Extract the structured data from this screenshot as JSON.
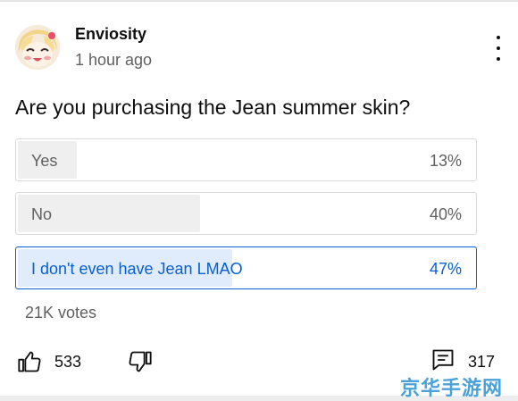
{
  "post": {
    "author": "Enviosity",
    "time": "1 hour ago",
    "question": "Are you purchasing the Jean summer skin?"
  },
  "poll": {
    "options": [
      {
        "label": "Yes",
        "percent_text": "13%",
        "percent": 13,
        "selected": false
      },
      {
        "label": "No",
        "percent_text": "40%",
        "percent": 40,
        "selected": false
      },
      {
        "label": "I don't even have Jean LMAO",
        "percent_text": "47%",
        "percent": 47,
        "selected": true
      }
    ],
    "votes": "21K votes"
  },
  "actions": {
    "likes": "533",
    "comments": "317"
  },
  "icons": {
    "menu": "more-vert-icon",
    "like": "thumbs-up-icon",
    "dislike": "thumbs-down-icon",
    "comment": "comment-icon"
  },
  "colors": {
    "accent": "#065fd4",
    "selected_fill": "#e0ecfc",
    "bar_fill": "#efefef",
    "muted_text": "#606060"
  },
  "watermark": "京华手游网"
}
